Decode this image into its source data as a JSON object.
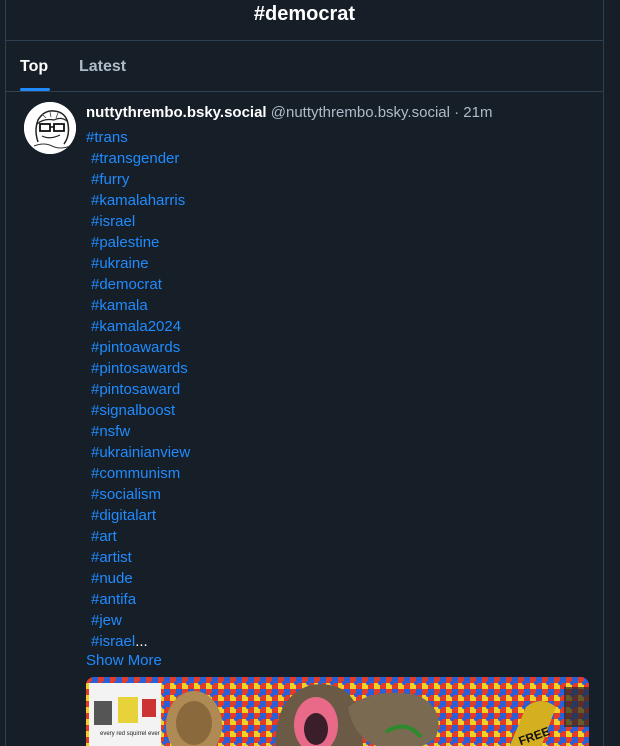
{
  "header": {
    "title": "#democrat"
  },
  "tabs": [
    {
      "label": "Top",
      "active": true
    },
    {
      "label": "Latest",
      "active": false
    }
  ],
  "post": {
    "display_name": "nuttythrembo.bsky.social",
    "handle": "@nuttythrembo.bsky.social",
    "separator": " · ",
    "time": "21m",
    "tags": [
      "#trans",
      "#transgender",
      "#furry",
      "#kamalaharris",
      "#israel",
      "#palestine",
      "#ukraine",
      "#democrat",
      "#kamala",
      "#kamala2024",
      "#pintoawards",
      "#pintosawards",
      "#pintosaward",
      "#signalboost",
      "#nsfw",
      "#ukrainianview",
      "#communism",
      "#socialism",
      "#digitalart",
      "#art",
      "#artist",
      "#nude",
      "#antifa",
      "#jew",
      "#israel"
    ],
    "truncation": "...",
    "show_more_label": "Show More",
    "image_text": [
      "every red squirrel ever",
      "FREE"
    ]
  },
  "colors": {
    "background": "#161e27",
    "border": "#2e4052",
    "link": "#208bfe",
    "muted": "#aebbc9"
  }
}
